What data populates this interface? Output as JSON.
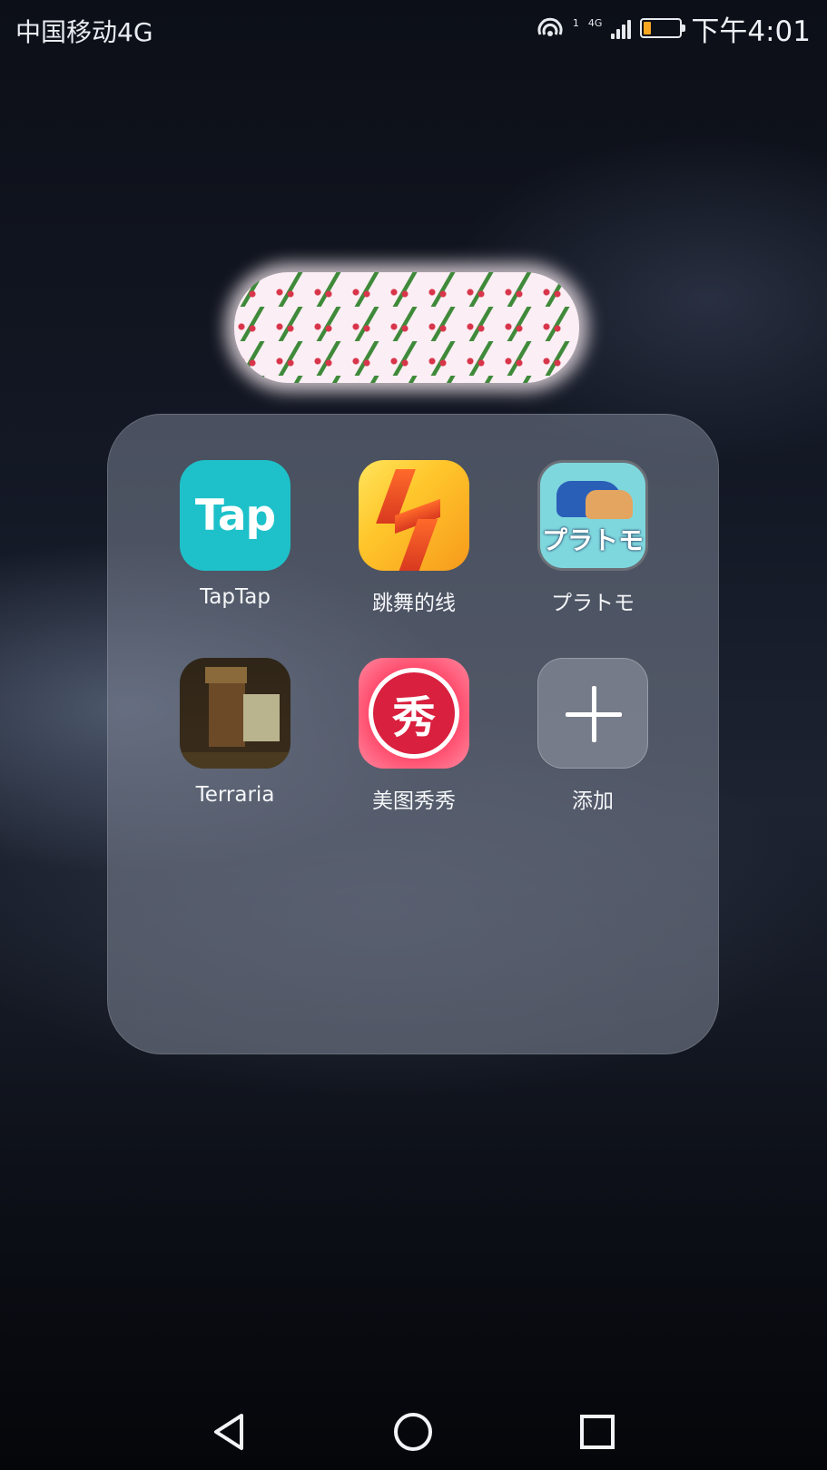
{
  "status_bar": {
    "carrier": "中国移动4G",
    "network_superscript": "1",
    "network_type": "4G",
    "time": "下午4:01",
    "battery_level_fraction": 0.2,
    "battery_color": "#f6a623",
    "icons": [
      "hotspot-icon",
      "signal-icon",
      "battery-icon"
    ]
  },
  "folder": {
    "title_background": "cherry-pattern",
    "apps": [
      {
        "label": "TapTap",
        "icon": "taptap-icon",
        "icon_text": "Tap",
        "color": "#1ec1c9"
      },
      {
        "label": "跳舞的线",
        "icon": "dancing-line-icon",
        "color": "#ffc62b"
      },
      {
        "label": "プラトモ",
        "icon": "puratomo-icon",
        "icon_text": "プラトモ",
        "color": "#7fd7de"
      },
      {
        "label": "Terraria",
        "icon": "terraria-icon",
        "color": "#3a2c1a"
      },
      {
        "label": "美图秀秀",
        "icon": "meitu-icon",
        "icon_text": "秀",
        "color": "#d9203e"
      },
      {
        "label": "添加",
        "icon": "add-icon"
      }
    ]
  },
  "nav_bar": {
    "buttons": [
      "back-icon",
      "home-icon",
      "recents-icon"
    ]
  }
}
